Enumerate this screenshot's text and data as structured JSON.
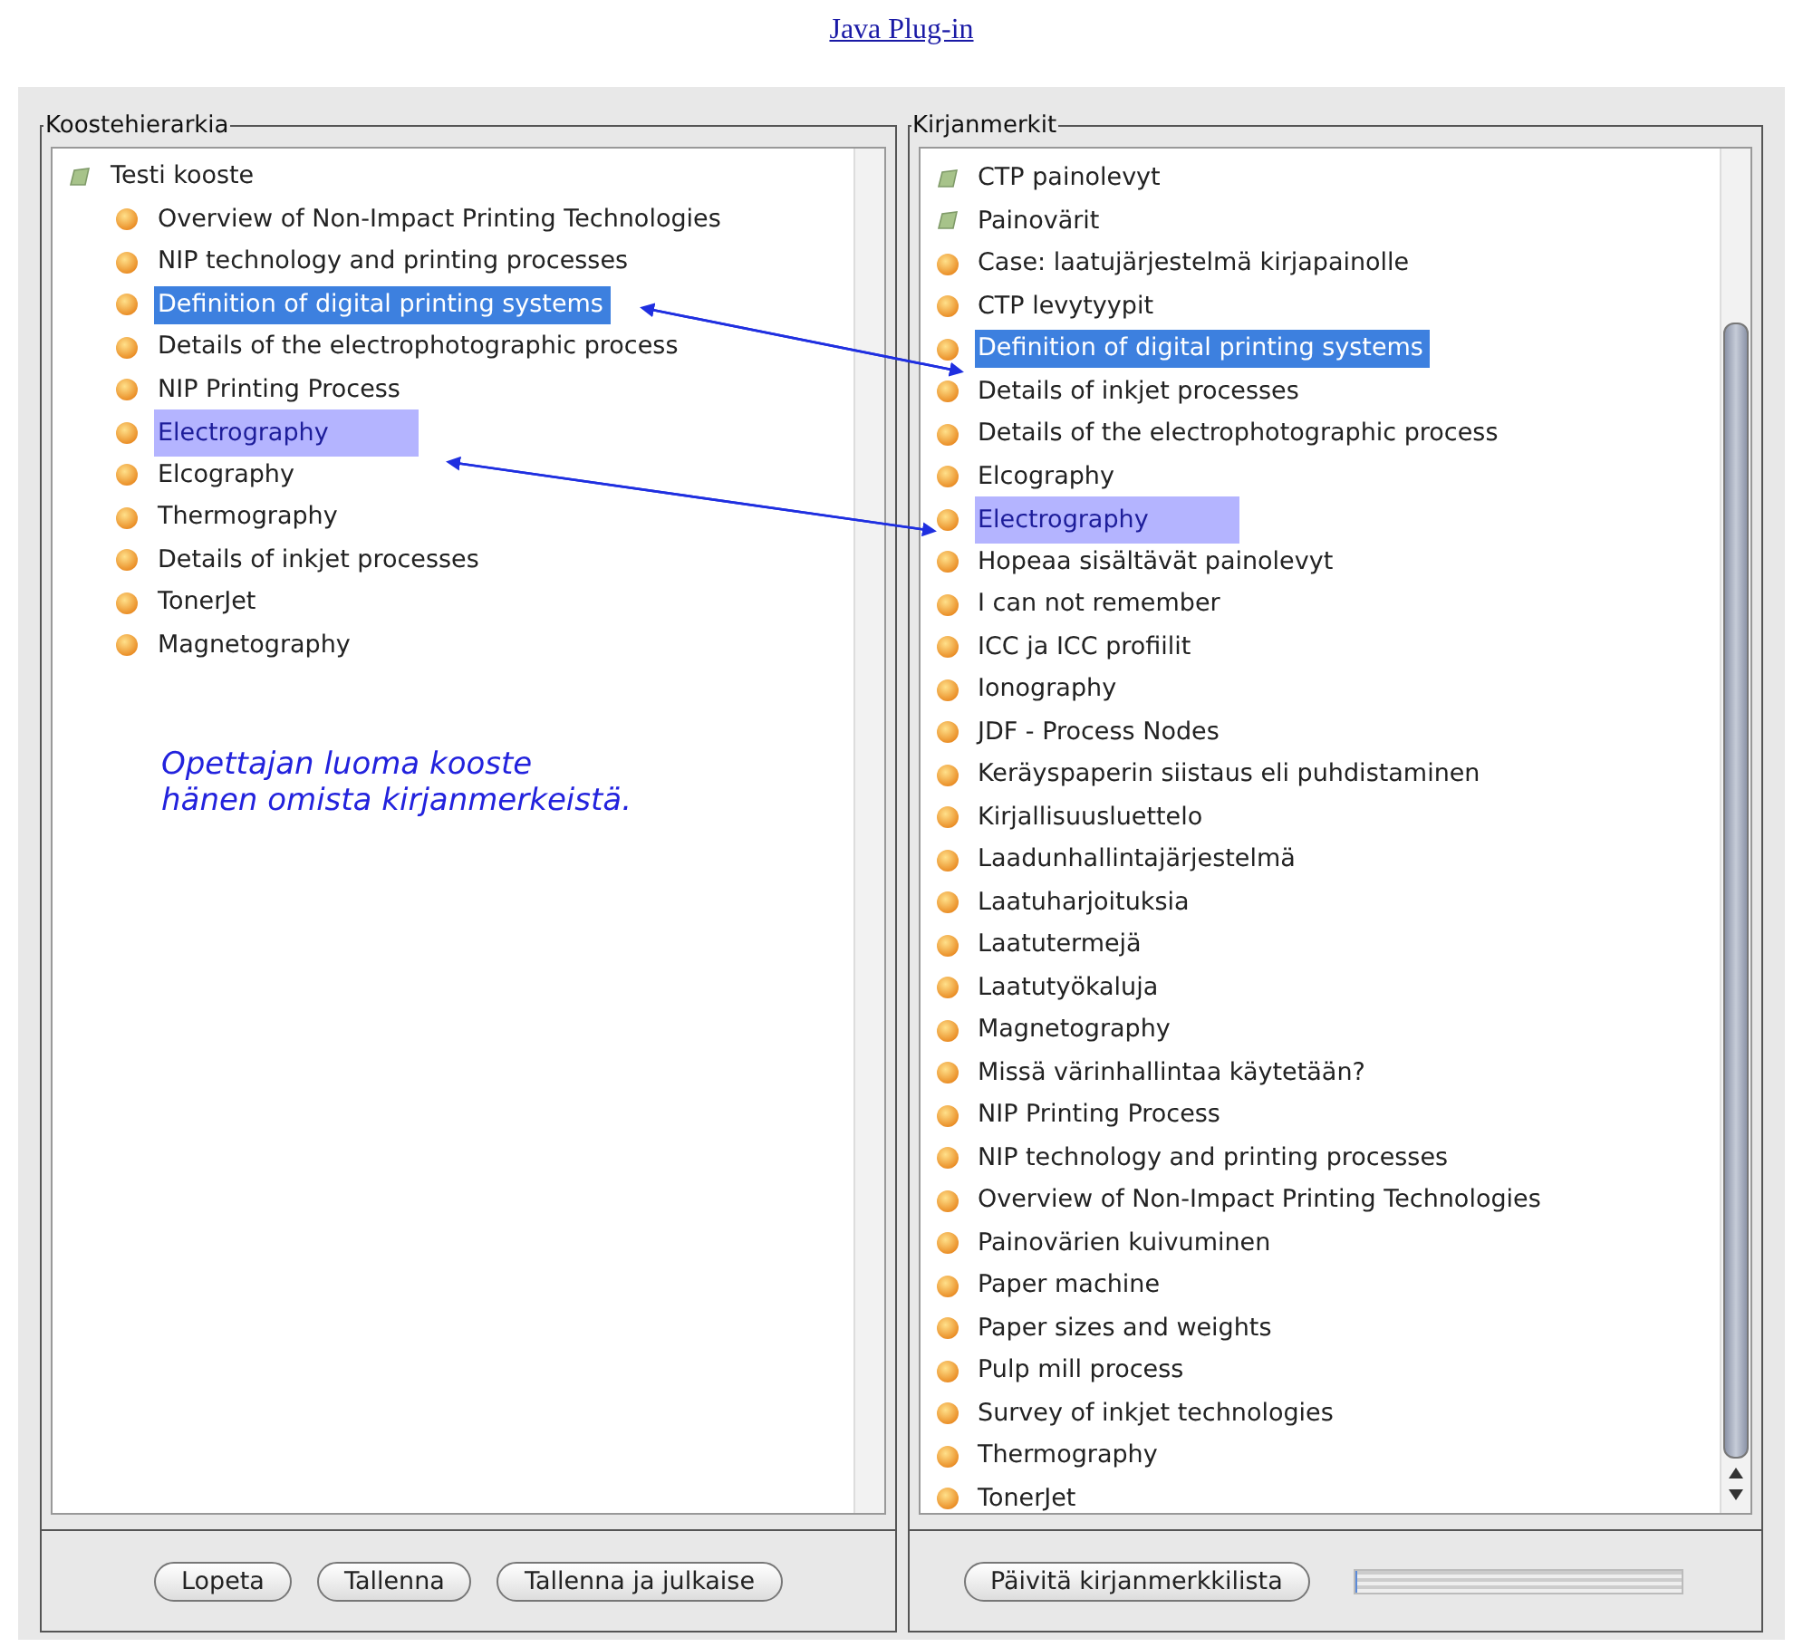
{
  "link": "Java Plug-in",
  "left_panel": {
    "title": "Koostehierarkia",
    "tree": {
      "label": "Testi kooste",
      "kind": "folder",
      "selected": false,
      "highlighted": false,
      "children": [
        {
          "label": "Overview of Non-Impact Printing Technologies",
          "kind": "bookmark",
          "selected": false,
          "highlighted": false
        },
        {
          "label": "NIP technology and printing processes",
          "kind": "bookmark",
          "selected": false,
          "highlighted": false
        },
        {
          "label": "Definition of digital printing systems",
          "kind": "bookmark",
          "selected": true,
          "highlighted": false
        },
        {
          "label": "Details of the electrophotographic process",
          "kind": "bookmark",
          "selected": false,
          "highlighted": false
        },
        {
          "label": "NIP Printing Process",
          "kind": "bookmark",
          "selected": false,
          "highlighted": false
        },
        {
          "label": "Electrography",
          "kind": "bookmark",
          "selected": false,
          "highlighted": true
        },
        {
          "label": "Elcography",
          "kind": "bookmark",
          "selected": false,
          "highlighted": false
        },
        {
          "label": "Thermography",
          "kind": "bookmark",
          "selected": false,
          "highlighted": false
        },
        {
          "label": "Details of inkjet processes",
          "kind": "bookmark",
          "selected": false,
          "highlighted": false
        },
        {
          "label": "TonerJet",
          "kind": "bookmark",
          "selected": false,
          "highlighted": false
        },
        {
          "label": "Magnetography",
          "kind": "bookmark",
          "selected": false,
          "highlighted": false
        }
      ]
    },
    "note": [
      "Opettajan luoma kooste",
      "hänen omista kirjanmerkeistä."
    ],
    "buttons": [
      "Lopeta",
      "Tallenna",
      "Tallenna ja julkaise"
    ]
  },
  "right_panel": {
    "title": "Kirjanmerkit",
    "items": [
      {
        "label": "CTP painolevyt",
        "kind": "folder",
        "selected": false,
        "highlighted": false
      },
      {
        "label": "Painovärit",
        "kind": "folder",
        "selected": false,
        "highlighted": false
      },
      {
        "label": "Case: laatujärjestelmä kirjapainolle",
        "kind": "bookmark",
        "selected": false,
        "highlighted": false
      },
      {
        "label": "CTP levytyypit",
        "kind": "bookmark",
        "selected": false,
        "highlighted": false
      },
      {
        "label": "Definition of digital printing systems",
        "kind": "bookmark",
        "selected": true,
        "highlighted": false
      },
      {
        "label": "Details of inkjet processes",
        "kind": "bookmark",
        "selected": false,
        "highlighted": false
      },
      {
        "label": "Details of the electrophotographic process",
        "kind": "bookmark",
        "selected": false,
        "highlighted": false
      },
      {
        "label": "Elcography",
        "kind": "bookmark",
        "selected": false,
        "highlighted": false
      },
      {
        "label": "Electrography",
        "kind": "bookmark",
        "selected": false,
        "highlighted": true
      },
      {
        "label": "Hopeaa sisältävät painolevyt",
        "kind": "bookmark",
        "selected": false,
        "highlighted": false
      },
      {
        "label": "I can not remember",
        "kind": "bookmark",
        "selected": false,
        "highlighted": false
      },
      {
        "label": "ICC ja ICC profiilit",
        "kind": "bookmark",
        "selected": false,
        "highlighted": false
      },
      {
        "label": "Ionography",
        "kind": "bookmark",
        "selected": false,
        "highlighted": false
      },
      {
        "label": "JDF - Process Nodes",
        "kind": "bookmark",
        "selected": false,
        "highlighted": false
      },
      {
        "label": "Keräyspaperin siistaus eli puhdistaminen",
        "kind": "bookmark",
        "selected": false,
        "highlighted": false
      },
      {
        "label": "Kirjallisuusluettelo",
        "kind": "bookmark",
        "selected": false,
        "highlighted": false
      },
      {
        "label": "Laadunhallintajärjestelmä",
        "kind": "bookmark",
        "selected": false,
        "highlighted": false
      },
      {
        "label": "Laatuharjoituksia",
        "kind": "bookmark",
        "selected": false,
        "highlighted": false
      },
      {
        "label": "Laatutermejä",
        "kind": "bookmark",
        "selected": false,
        "highlighted": false
      },
      {
        "label": "Laatutyökaluja",
        "kind": "bookmark",
        "selected": false,
        "highlighted": false
      },
      {
        "label": "Magnetography",
        "kind": "bookmark",
        "selected": false,
        "highlighted": false
      },
      {
        "label": "Missä värinhallintaa käytetään?",
        "kind": "bookmark",
        "selected": false,
        "highlighted": false
      },
      {
        "label": "NIP Printing Process",
        "kind": "bookmark",
        "selected": false,
        "highlighted": false
      },
      {
        "label": "NIP technology and printing processes",
        "kind": "bookmark",
        "selected": false,
        "highlighted": false
      },
      {
        "label": "Overview of Non-Impact Printing Technologies",
        "kind": "bookmark",
        "selected": false,
        "highlighted": false
      },
      {
        "label": "Painovärien kuivuminen",
        "kind": "bookmark",
        "selected": false,
        "highlighted": false
      },
      {
        "label": "Paper machine",
        "kind": "bookmark",
        "selected": false,
        "highlighted": false
      },
      {
        "label": "Paper sizes and weights",
        "kind": "bookmark",
        "selected": false,
        "highlighted": false
      },
      {
        "label": "Pulp mill process",
        "kind": "bookmark",
        "selected": false,
        "highlighted": false
      },
      {
        "label": "Survey of inkjet technologies",
        "kind": "bookmark",
        "selected": false,
        "highlighted": false
      },
      {
        "label": "Thermography",
        "kind": "bookmark",
        "selected": false,
        "highlighted": false
      },
      {
        "label": "TonerJet",
        "kind": "bookmark",
        "selected": false,
        "highlighted": false
      }
    ],
    "buttons": [
      "Päivitä kirjanmerkkilista"
    ],
    "progress": {
      "level": 0
    }
  }
}
